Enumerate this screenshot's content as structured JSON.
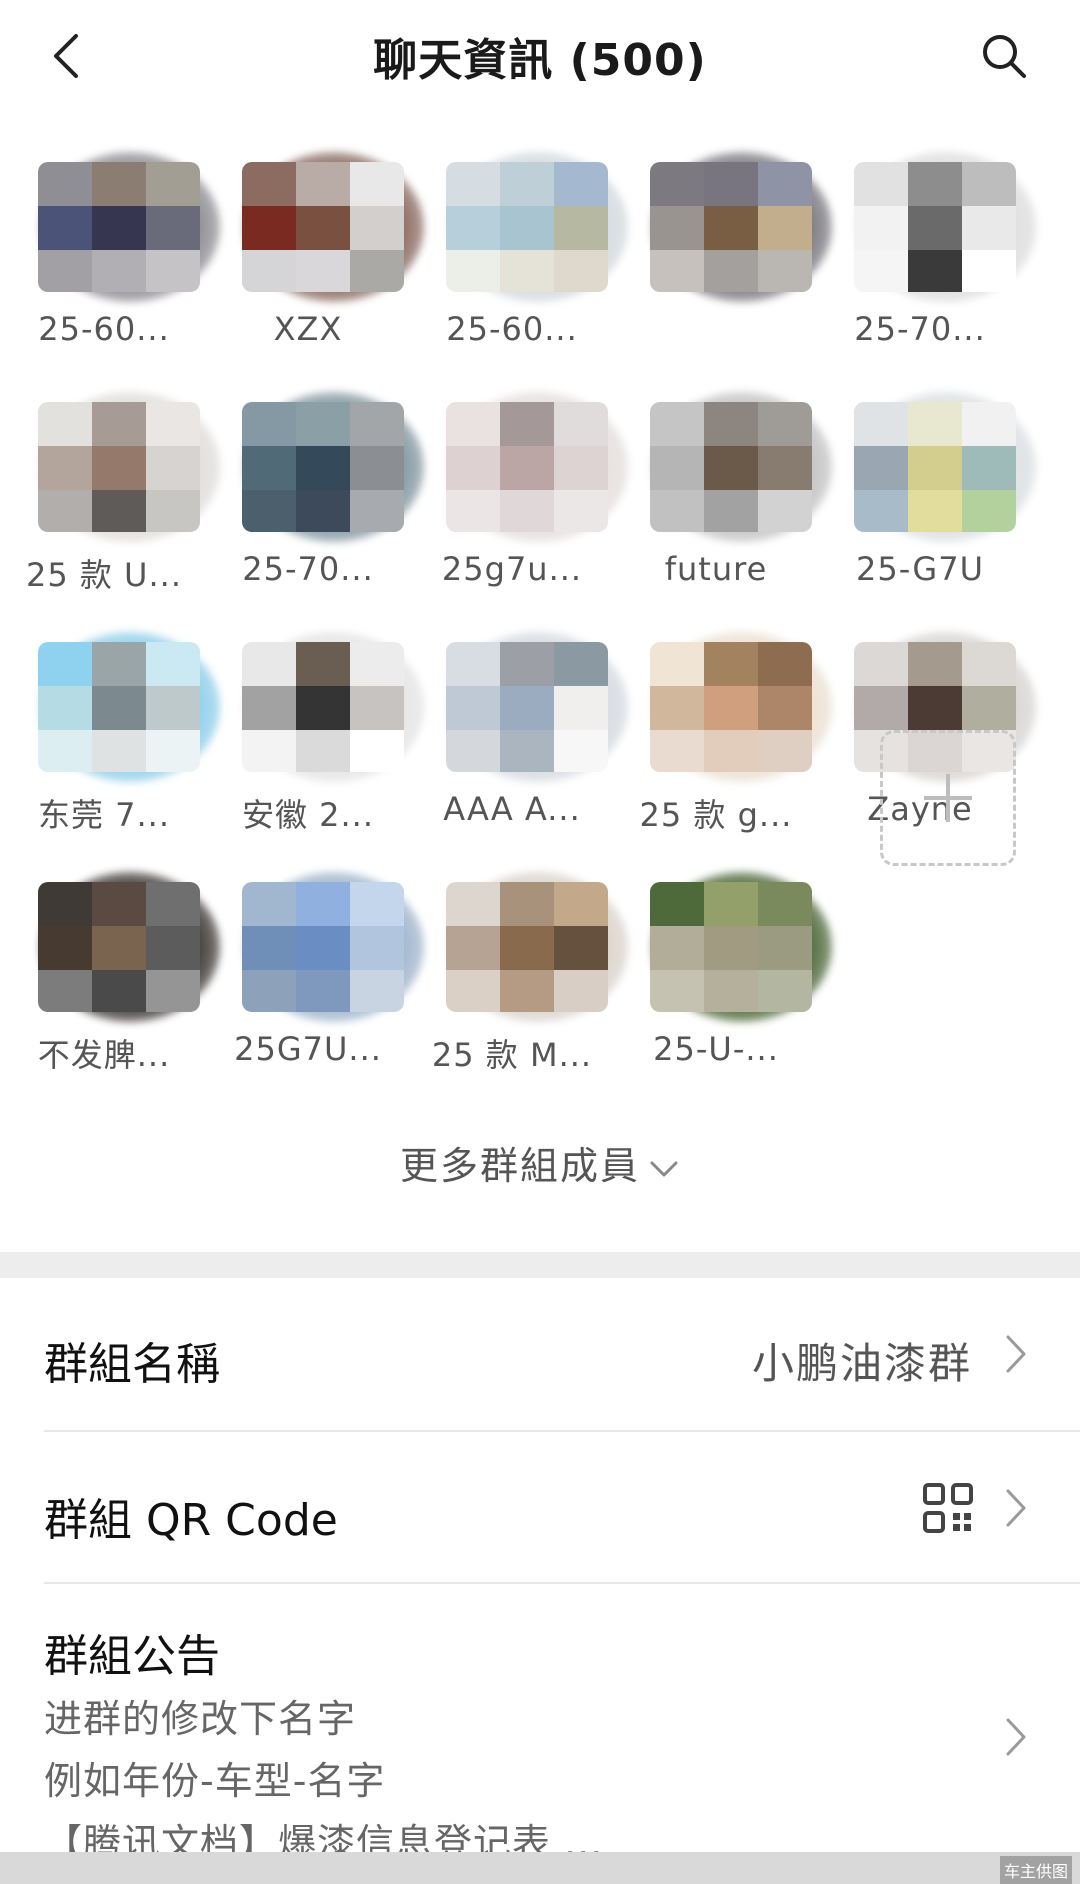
{
  "header": {
    "title": "聊天資訊 (500)",
    "back_icon": "chevron-left-icon",
    "search_icon": "search-icon"
  },
  "members": [
    {
      "name": "25-60...",
      "colors": [
        "#8f8e94",
        "#8c7d72",
        "#a39e94",
        "#4c5378",
        "#363650",
        "#6a6b7a",
        "#a2a0a4",
        "#b1afb4",
        "#c6c3c6"
      ]
    },
    {
      "name": "XZX",
      "colors": [
        "#8c6b60",
        "#b9aba6",
        "#e8e8e8",
        "#7a2a20",
        "#7a5040",
        "#d3cfcd",
        "#d5d4d7",
        "#d9d7da",
        "#aba9a6"
      ]
    },
    {
      "name": "25-60...",
      "colors": [
        "#d6dde2",
        "#bfcfd7",
        "#a4b9cf",
        "#b7cfdb",
        "#a8c4d1",
        "#b6b8a2",
        "#ecefe8",
        "#e5e3d8",
        "#ded8cd"
      ]
    },
    {
      "name": "",
      "colors": [
        "#7c7a80",
        "#787580",
        "#8e94a6",
        "#9a9490",
        "#7a5e44",
        "#c2ad8c",
        "#c6c1bc",
        "#a4a09e",
        "#bab6b2"
      ]
    },
    {
      "name": "25-70...",
      "colors": [
        "#e1e1e1",
        "#8d8d8d",
        "#bdbdbd",
        "#f2f2f2",
        "#6a6a6a",
        "#e9e9e9",
        "#f5f5f5",
        "#3a3a3a",
        "#ffffff"
      ]
    },
    {
      "name": "25 款 U...",
      "colors": [
        "#e3e1de",
        "#a69c95",
        "#e9e6e4",
        "#b3a49c",
        "#957a6c",
        "#d6d3d0",
        "#b1aeac",
        "#5e5b58",
        "#c8c6c3"
      ]
    },
    {
      "name": "25-70...",
      "colors": [
        "#8499a3",
        "#8a9fa6",
        "#a3a6a8",
        "#506a77",
        "#34495a",
        "#8b8f94",
        "#4b5f6c",
        "#3c4a5c",
        "#a7aaae"
      ]
    },
    {
      "name": "25g7u...",
      "colors": [
        "#e9e2e1",
        "#a59898",
        "#e1dcdc",
        "#ddd1d2",
        "#bba6a5",
        "#ddd3d3",
        "#ebe5e6",
        "#e0d8d8",
        "#ece7e7"
      ]
    },
    {
      "name": "future",
      "colors": [
        "#c5c5c5",
        "#8c8580",
        "#9f9c98",
        "#b5b5b5",
        "#6b5a4a",
        "#887b70",
        "#c1c1c1",
        "#a2a2a2",
        "#d2d2d2"
      ]
    },
    {
      "name": "25-G7U",
      "colors": [
        "#dfe3e6",
        "#e8e7cf",
        "#f1f1f1",
        "#9aa7b2",
        "#d3cd8e",
        "#9ebab9",
        "#a7bbc8",
        "#e3dd9d",
        "#b2d19d"
      ]
    },
    {
      "name": "东莞 7...",
      "colors": [
        "#8fd2ef",
        "#9aa5a8",
        "#cae9f3",
        "#b5dbe5",
        "#7c8a8f",
        "#bdc9cb",
        "#dceef1",
        "#dfe2e3",
        "#ecf3f5"
      ]
    },
    {
      "name": "安徽 2...",
      "colors": [
        "#e8e8e8",
        "#6a5e52",
        "#ececec",
        "#a2a2a2",
        "#343434",
        "#c6c3c0",
        "#f3f3f3",
        "#dadada",
        "#ffffff"
      ]
    },
    {
      "name": "AAA A...",
      "colors": [
        "#d8dde4",
        "#9ca0a6",
        "#8b99a3",
        "#bfc9d6",
        "#9bacc0",
        "#f0efed",
        "#d4d8dd",
        "#aab5c0",
        "#f7f7f7"
      ]
    },
    {
      "name": "25 款 g...",
      "colors": [
        "#f0e4d4",
        "#a3825f",
        "#8e6c50",
        "#d1b79c",
        "#cf9f7e",
        "#ad8568",
        "#eadbd0",
        "#e2cdbd",
        "#dfcfc2"
      ]
    },
    {
      "name": "Zayne",
      "colors": [
        "#dbd8d6",
        "#a49a8e",
        "#dcd8d4",
        "#b2aaa9",
        "#4c3a35",
        "#b0ae9f",
        "#e5e2e0",
        "#dbd6d4",
        "#e9e6e4"
      ]
    },
    {
      "name": "不发脾...",
      "colors": [
        "#3f3a36",
        "#5a4a42",
        "#6f6f6f",
        "#473a30",
        "#7a6450",
        "#5c5c5c",
        "#7c7c7c",
        "#4a4a4a",
        "#959595"
      ]
    },
    {
      "name": "25G7U...",
      "colors": [
        "#a1b7cf",
        "#90b1e0",
        "#c4d6ec",
        "#6f8fb8",
        "#6a8ec3",
        "#b1c5de",
        "#8da2ba",
        "#7f98bd",
        "#c8d4e2"
      ]
    },
    {
      "name": "25 款 M...",
      "colors": [
        "#ddd6cf",
        "#a9927c",
        "#c4a88a",
        "#b6a393",
        "#8a6a4c",
        "#66503e",
        "#dad0c6",
        "#b69b84",
        "#d9cec6"
      ]
    },
    {
      "name": "25-U-...",
      "colors": [
        "#4f6a3a",
        "#93a06a",
        "#7a8a5c",
        "#b2ad99",
        "#a19b82",
        "#9b9b82",
        "#c6c2b1",
        "#b5b09c",
        "#b3b6a0"
      ]
    }
  ],
  "add_member_icon": "plus-icon",
  "more_members": {
    "label": "更多群組成員",
    "icon": "chevron-down-icon"
  },
  "settings": {
    "group_name": {
      "label": "群組名稱",
      "value": "小鹏油漆群"
    },
    "group_qr": {
      "label": "群組 QR Code",
      "icon": "qr-code-icon"
    },
    "announcement": {
      "label": "群組公告",
      "lines": [
        "进群的修改下名字",
        "例如年份-车型-名字",
        "【腾讯文档】爆漆信息登记表 ..."
      ]
    }
  },
  "watermark": "车主供图"
}
